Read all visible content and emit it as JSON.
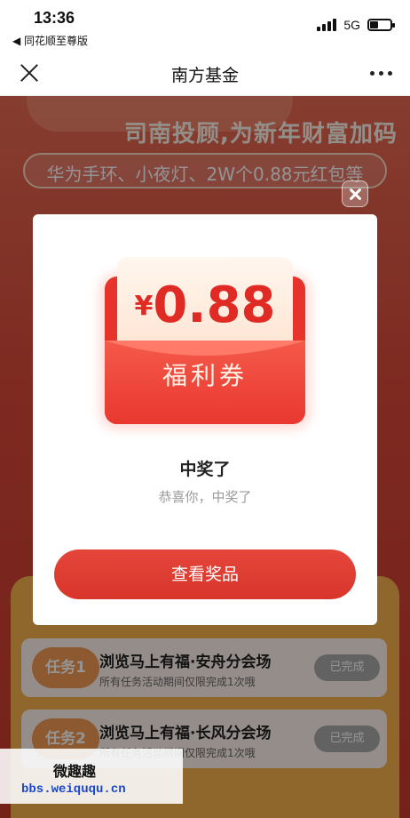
{
  "status_bar": {
    "time": "13:36",
    "back_app": "◀ 同花顺至尊版",
    "network": "5G"
  },
  "nav": {
    "title": "南方基金"
  },
  "background": {
    "headline": "司南投顾,为新年财富加码",
    "subline": "华为手环、小夜灯、2W个0.88元红包等",
    "tasks": [
      {
        "badge": "任务1",
        "title": "浏览马上有福·安舟分会场",
        "sub": "所有任务活动期间仅限完成1次哦",
        "status": "已完成"
      },
      {
        "badge": "任务2",
        "title": "浏览马上有福·长风分会场",
        "sub": "所有任务活动期间仅限完成1次哦",
        "status": "已完成"
      }
    ]
  },
  "modal": {
    "currency": "¥",
    "amount": "0.88",
    "envelope_label": "福利券",
    "title": "中奖了",
    "description": "恭喜你，中奖了",
    "button": "查看奖品"
  },
  "watermark": {
    "title": "微趣趣",
    "url": "bbs.weiququ.cn"
  }
}
